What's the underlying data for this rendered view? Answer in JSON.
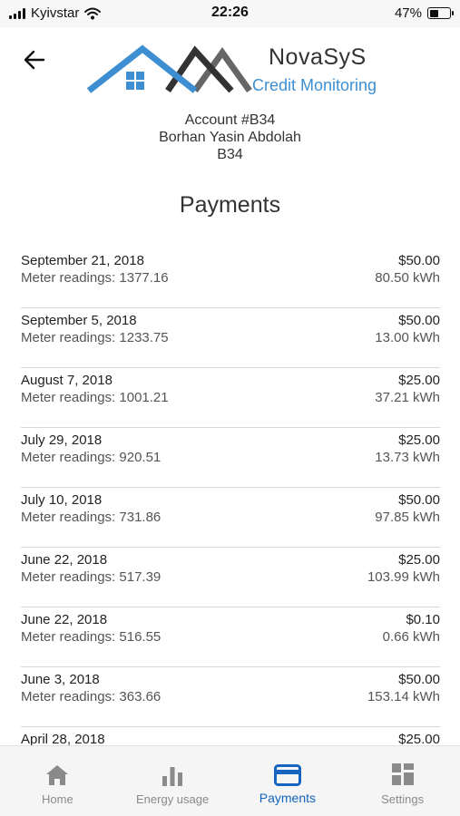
{
  "status_bar": {
    "carrier": "Kyivstar",
    "time": "22:26",
    "battery_percent": "47%",
    "battery_level": 0.47,
    "wifi_icon": "wifi-icon",
    "signal_icon": "signal-icon"
  },
  "header": {
    "back_icon": "arrow-left-icon",
    "brand_name": "NovaSyS",
    "brand_tagline": "Credit Monitoring",
    "colors": {
      "roof_blue": "#3e8fd1",
      "roof_dark": "#333333",
      "roof_gray": "#666666"
    }
  },
  "account": {
    "number": "Account #B34",
    "name": "Borhan Yasin Abdolah",
    "code": "B34"
  },
  "page_title": "Payments",
  "payments": [
    {
      "date": "September 21, 2018",
      "meter": "Meter readings: 1377.16",
      "amount": "$50.00",
      "kwh": "80.50 kWh"
    },
    {
      "date": "September 5, 2018",
      "meter": "Meter readings: 1233.75",
      "amount": "$50.00",
      "kwh": "13.00 kWh"
    },
    {
      "date": "August 7, 2018",
      "meter": "Meter readings: 1001.21",
      "amount": "$25.00",
      "kwh": "37.21 kWh"
    },
    {
      "date": "July 29, 2018",
      "meter": "Meter readings: 920.51",
      "amount": "$25.00",
      "kwh": "13.73 kWh"
    },
    {
      "date": "July 10, 2018",
      "meter": "Meter readings: 731.86",
      "amount": "$50.00",
      "kwh": "97.85 kWh"
    },
    {
      "date": "June 22, 2018",
      "meter": "Meter readings: 517.39",
      "amount": "$25.00",
      "kwh": "103.99 kWh"
    },
    {
      "date": "June 22, 2018",
      "meter": "Meter readings: 516.55",
      "amount": "$0.10",
      "kwh": "0.66 kWh"
    },
    {
      "date": "June 3, 2018",
      "meter": "Meter readings: 363.66",
      "amount": "$50.00",
      "kwh": "153.14 kWh"
    },
    {
      "date": "April 28, 2018",
      "meter": "",
      "amount": "$25.00",
      "kwh": ""
    }
  ],
  "tabs": [
    {
      "label": "Home",
      "icon": "home-icon",
      "active": false
    },
    {
      "label": "Energy usage",
      "icon": "bar-chart-icon",
      "active": false
    },
    {
      "label": "Payments",
      "icon": "credit-card-icon",
      "active": true
    },
    {
      "label": "Settings",
      "icon": "grid-icon",
      "active": false
    }
  ],
  "colors": {
    "accent": "#1565c0",
    "inactive": "#8a8a8a"
  }
}
